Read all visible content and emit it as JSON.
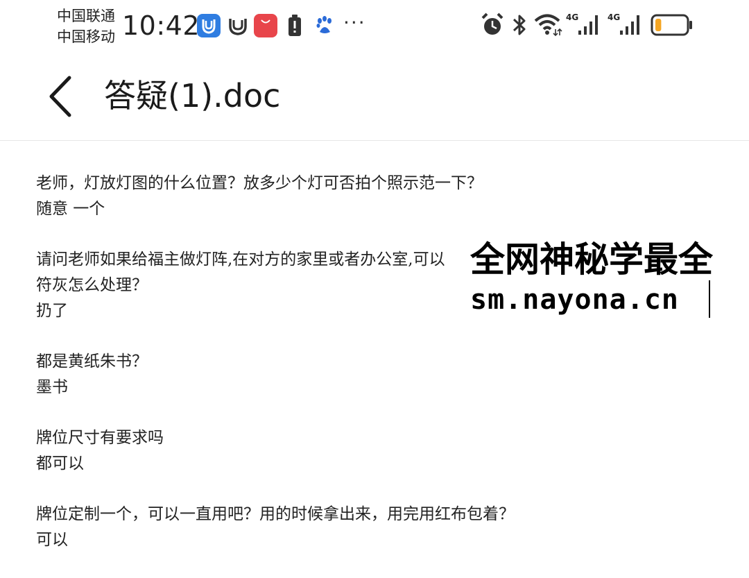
{
  "status_bar": {
    "carrier_1": "中国联通",
    "carrier_2": "中国移动",
    "time": "10:42",
    "more": "···",
    "net_1": "4G",
    "net_2": "4G",
    "huawei_label": "HUAWEI",
    "baidu_label": "du",
    "battery_level": 0.2,
    "battery_color": "#f5a623"
  },
  "header": {
    "title": "答疑(1).doc"
  },
  "document": {
    "items": [
      {
        "lines": [
          "老师，灯放灯图的什么位置？放多少个灯可否拍个照示范一下？",
          "随意 一个"
        ]
      },
      {
        "lines": [
          "请问老师如果给福主做灯阵,在对方的家里或者办公室,可以",
          "符灰怎么处理？",
          "扔了"
        ]
      },
      {
        "lines": [
          "都是黄纸朱书？",
          "墨书"
        ]
      },
      {
        "lines": [
          "牌位尺寸有要求吗",
          "都可以"
        ]
      },
      {
        "lines": [
          "牌位定制一个，可以一直用吧？用的时候拿出来，用完用红布包着？",
          "可以"
        ]
      }
    ]
  },
  "watermark": {
    "line1": "全网神秘学最全",
    "line2": "sm.nayona.cn"
  }
}
